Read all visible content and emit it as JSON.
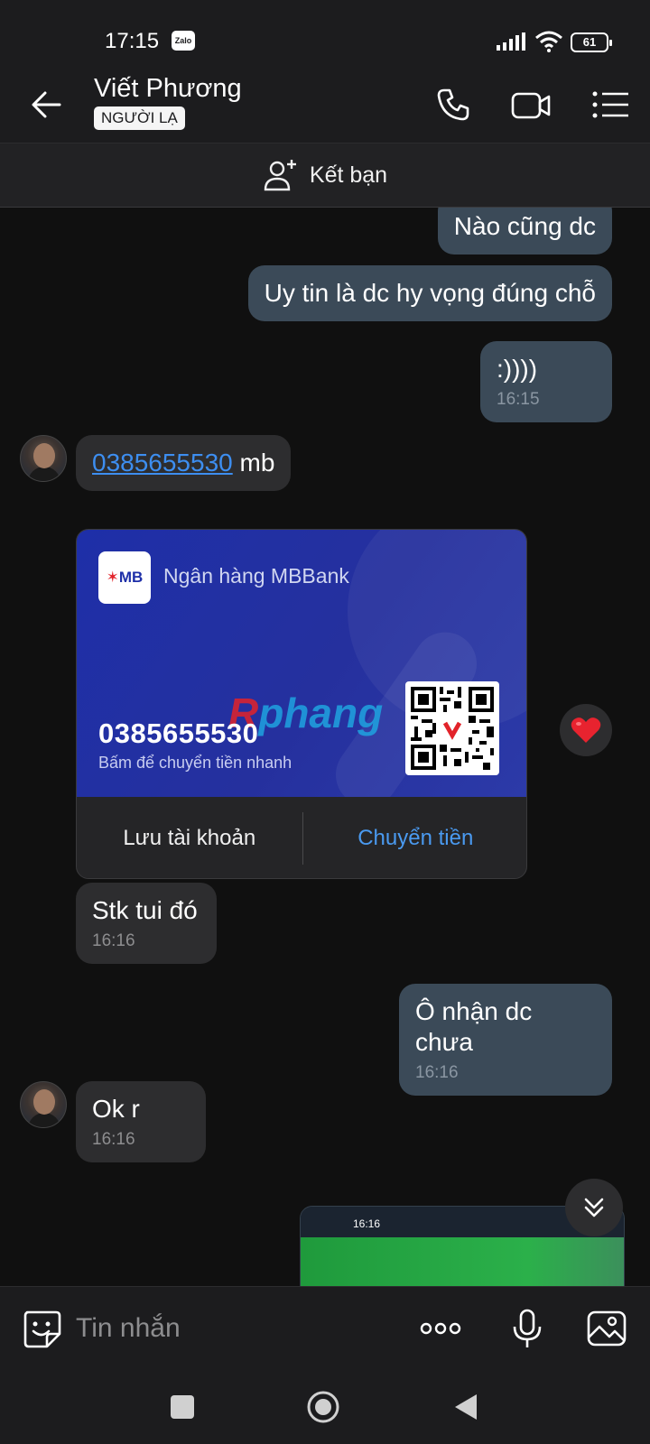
{
  "status_bar": {
    "time": "17:15",
    "app_badge": "Zalo",
    "battery": "61"
  },
  "header": {
    "contact_name": "Viết Phương",
    "badge": "NGƯỜI LẠ"
  },
  "add_friend": {
    "label": "Kết bạn"
  },
  "messages": {
    "m1": {
      "text": "Nào cũng dc"
    },
    "m2": {
      "text": "Uy tin là dc hy vọng đúng chỗ"
    },
    "m3": {
      "text": ":))))",
      "time": "16:15"
    },
    "m4": {
      "phone": "0385655530",
      "suffix": " mb"
    },
    "m6": {
      "text": "Stk tui đó",
      "time": "16:16"
    },
    "m7": {
      "text": "Ô nhận dc chưa",
      "time": "16:16"
    },
    "m8": {
      "text": "Ok r",
      "time": "16:16"
    }
  },
  "bank_card": {
    "logo": "MB",
    "bank_name": "Ngân hàng MBBank",
    "account_number": "0385655530",
    "subtitle": "Bấm để chuyển tiền nhanh",
    "save_label": "Lưu tài khoản",
    "transfer_label": "Chuyển tiền",
    "watermark_r": "R",
    "watermark_rest": "phang",
    "reaction": "heart-icon"
  },
  "thumbnail": {
    "time": "16:16"
  },
  "input": {
    "placeholder": "Tin nhắn"
  },
  "colors": {
    "outgoing_bubble": "#3b4a58",
    "incoming_bubble": "#2d2d2f",
    "link": "#3d8ef0",
    "bank_card": "#1e2fa8",
    "accent": "#4a9af0"
  }
}
